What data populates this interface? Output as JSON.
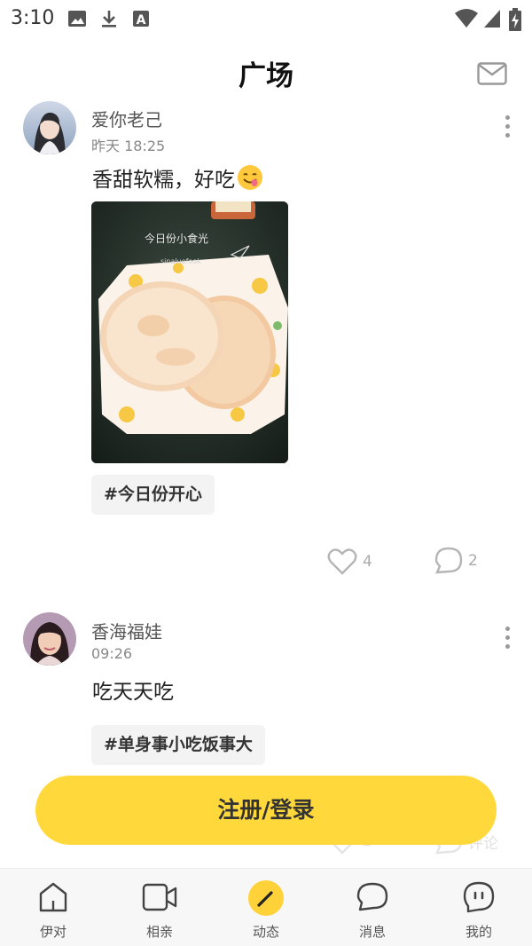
{
  "status_bar": {
    "time": "3:10",
    "left_icons": [
      "image-icon",
      "download-icon",
      "font-a-icon"
    ],
    "right_icons": [
      "wifi-icon",
      "signal-icon",
      "battery-charging-icon"
    ]
  },
  "header": {
    "title": "广场",
    "mail_icon": "mail-icon"
  },
  "posts": [
    {
      "username": "爱你老己",
      "time": "昨天 18:25",
      "text": "香甜软糯，好吃",
      "emoji": "😋",
      "photo_caption": "今日份小食光",
      "photo_watermark": "sinaluefook",
      "tag": "#今日份开心",
      "likes": "4",
      "comments": "2"
    },
    {
      "username": "香海福娃",
      "time": "09:26",
      "text": "吃天天吃",
      "tag": "#单身事小吃饭事大",
      "likes": "2",
      "comments_label": "评论"
    }
  ],
  "cta": {
    "label": "注册/登录"
  },
  "colors": {
    "accent": "#FFD93B",
    "nav_bg": "#f7f7f7"
  },
  "bottom_nav": [
    {
      "label": "伊对",
      "icon": "home-icon"
    },
    {
      "label": "相亲",
      "icon": "video-icon"
    },
    {
      "label": "动态",
      "icon": "pen-icon"
    },
    {
      "label": "消息",
      "icon": "message-icon"
    },
    {
      "label": "我的",
      "icon": "profile-icon"
    }
  ]
}
